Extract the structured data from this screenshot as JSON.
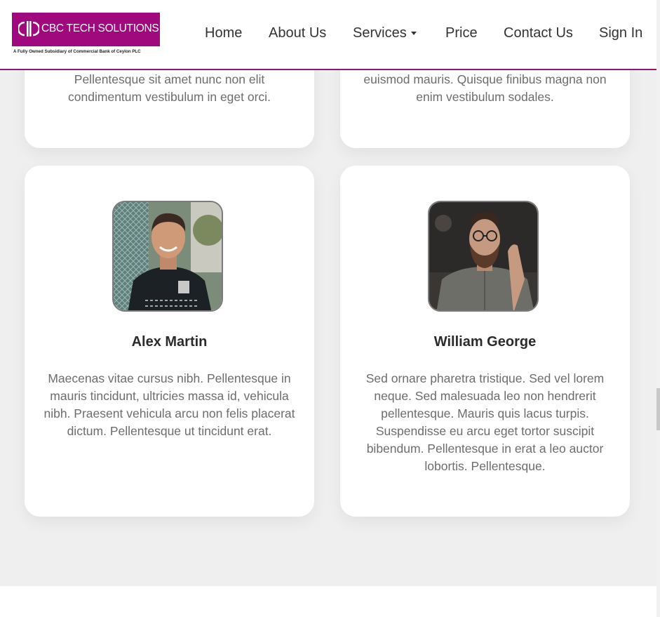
{
  "header": {
    "logo_text": "CBC TECH SOLUTIONS",
    "logo_tagline": "A Fully Owned Subsidiary of Commercial Bank of Ceylon PLC",
    "brand_color": "#a0097e",
    "nav": {
      "home": "Home",
      "about": "About Us",
      "services": "Services",
      "price": "Price",
      "contact": "Contact Us",
      "signin": "Sign In"
    }
  },
  "cards": [
    {
      "text": "Pellentesque sit amet nunc non elit condimentum vestibulum in eget orci."
    },
    {
      "text": "euismod mauris. Quisque finibus magna non enim vestibulum sodales."
    },
    {
      "name": "Alex Martin",
      "photo": "avatar-photo",
      "text": "Maecenas vitae cursus nibh. Pellentesque in mauris tincidunt, ultricies massa id, vehicula nibh. Praesent vehicula arcu non felis placerat dictum. Pellentesque ut tincidunt erat."
    },
    {
      "name": "William George",
      "photo": "avatar-photo",
      "text": "Sed ornare pharetra tristique. Sed vel lorem neque. Sed malesuada leo non hendrerit pellentesque. Mauris quis lacus turpis. Suspendisse eu arcu eget tortor suscipit bibendum. Pellentesque in erat a leo auctor lobortis. Pellentesque."
    }
  ]
}
